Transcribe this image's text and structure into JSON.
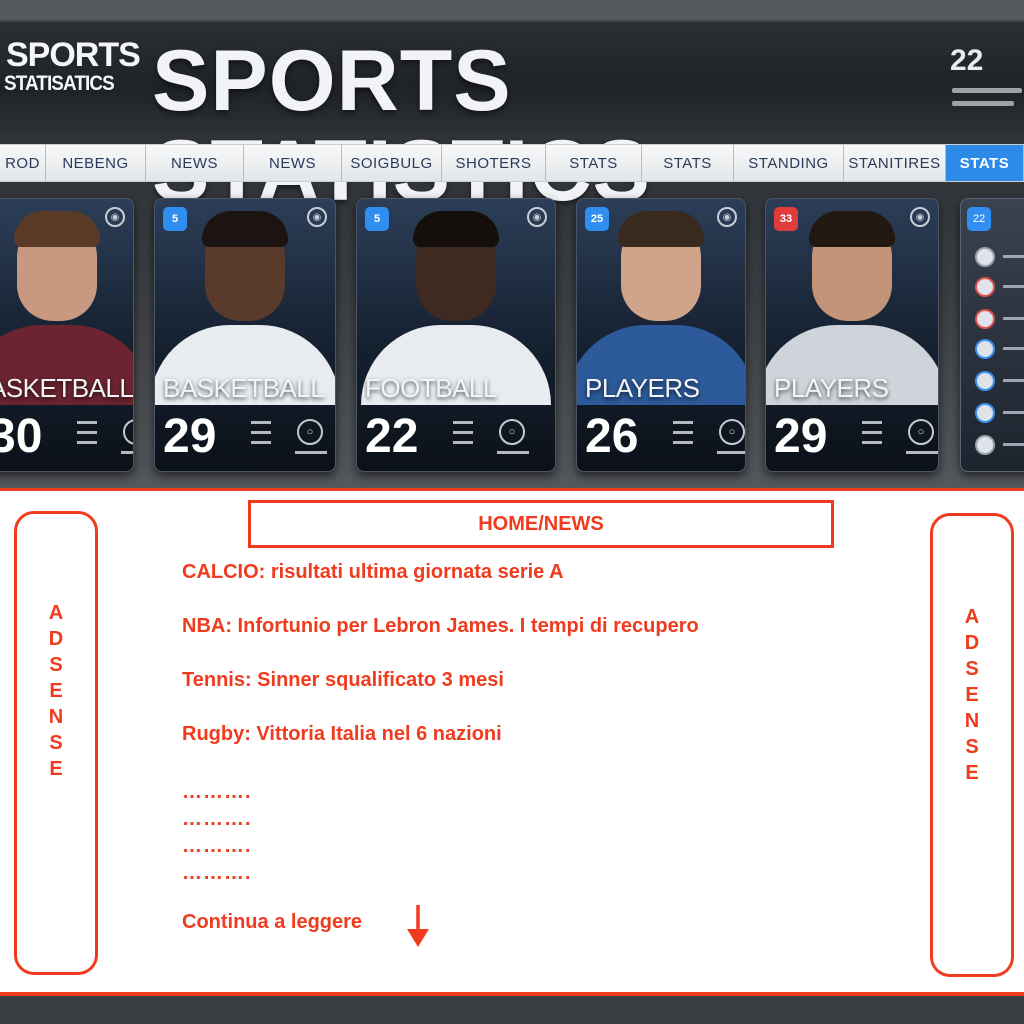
{
  "brand": {
    "line1": "SPORTS",
    "line2": "STATISATICS"
  },
  "header": {
    "title": "SPORTS STATISTICS",
    "number": "22"
  },
  "nav": {
    "tabs": [
      {
        "label": "ROD",
        "width": 46,
        "active": false
      },
      {
        "label": "NEBENG",
        "width": 100,
        "active": false
      },
      {
        "label": "NEWS",
        "width": 98,
        "active": false
      },
      {
        "label": "NEWS",
        "width": 98,
        "active": false
      },
      {
        "label": "SOIGBULG",
        "width": 100,
        "active": false
      },
      {
        "label": "SHOTERS",
        "width": 104,
        "active": false
      },
      {
        "label": "STATS",
        "width": 96,
        "active": false
      },
      {
        "label": "STATS",
        "width": 92,
        "active": false
      },
      {
        "label": "STANDING",
        "width": 110,
        "active": false
      },
      {
        "label": "STANITIRES",
        "width": 102,
        "active": false
      },
      {
        "label": "STATS",
        "width": 78,
        "active": true
      }
    ]
  },
  "cards": [
    {
      "sport": "ASKETBALL",
      "number": "30",
      "badge": "",
      "badge_color": "#e23b3b"
    },
    {
      "sport": "BASKETBALL",
      "number": "29",
      "badge": "5",
      "badge_color": "#2f8ef0"
    },
    {
      "sport": "FOOTBALL",
      "number": "22",
      "badge": "5",
      "badge_color": "#2f8ef0"
    },
    {
      "sport": "PLAYERS",
      "number": "26",
      "badge": "25",
      "badge_color": "#2f8ef0"
    },
    {
      "sport": "PLAYERS",
      "number": "29",
      "badge": "33",
      "badge_color": "#e23b3b"
    }
  ],
  "side_panel": {
    "badge": "22"
  },
  "content": {
    "section_title": "HOME/NEWS",
    "ads_left": "ADSENSE",
    "ads_right": "ADSENSE",
    "news": [
      "CALCIO: risultati ultima giornata serie A",
      "NBA: Infortunio per Lebron James. I tempi di recupero",
      "Tennis: Sinner squalificato 3 mesi",
      "Rugby: Vittoria Italia nel 6 nazioni"
    ],
    "dots": [
      "……….",
      "……….",
      "……….",
      "………."
    ],
    "read_more": "Continua a leggere"
  },
  "colors": {
    "accent": "#ef3b1e",
    "nav_active": "#2d8be8"
  }
}
